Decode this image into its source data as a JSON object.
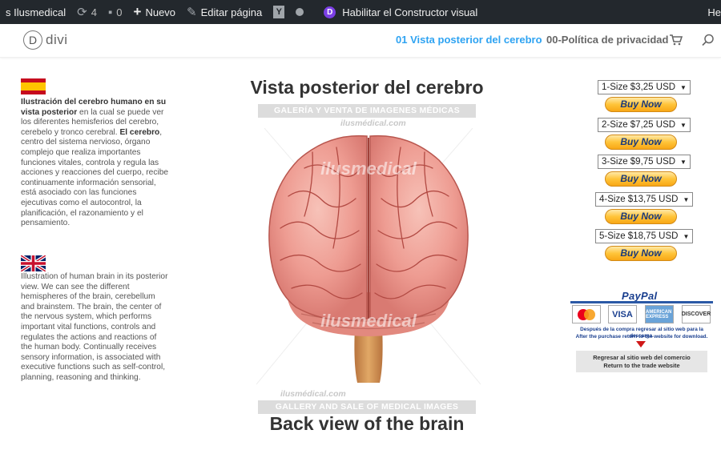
{
  "adminbar": {
    "site_name": "s Ilusmedical",
    "updates_count": "4",
    "comments_count": "0",
    "new_label": "Nuevo",
    "edit_label": "Editar página",
    "builder_label": "Habilitar el Constructor visual",
    "right_label": "He"
  },
  "header": {
    "logo_letter": "D",
    "logo_text": "divi",
    "nav_active": "01 Vista posterior del cerebro",
    "nav_item": "00-Política de privacidad"
  },
  "content": {
    "desc_es_bold1": "Ilustración del cerebro humano en su vista posterior",
    "desc_es_text1": " en la cual se puede ver los diferentes hemisferios del cerebro, cerebelo y tronco cerebral. ",
    "desc_es_bold2": "El cerebro",
    "desc_es_text2": ", centro del sistema nervioso, órgano complejo que realiza importantes funciones vitales, controla y regula las acciones y reacciones del cuerpo, recibe continuamente información sensorial, está asociado con las funciones ejecutivas como el autocontrol, la planificación, el razonamiento y el pensamiento.",
    "desc_en": "Illustration of human brain in its posterior view. We can see the different hemispheres of the brain, cerebellum and brainstem. The brain, the center of the nervous system, which performs important vital functions, controls and regulates the actions and reactions of the human body. Continually receives sensory information, is associated with executive functions such as self-control, planning, reasoning and thinking.",
    "title_es": "Vista posterior del cerebro",
    "title_en": "Back view of the brain",
    "banner_top": "GALERÍA Y VENTA DE IMAGENES MÉDICAS",
    "banner_bottom": "GALLERY AND SALE OF MEDICAL IMAGES",
    "site_mark_top": "ilusmédical.com",
    "site_mark_bottom": "ilusmédical.com",
    "watermark_1": "ilusmedical",
    "watermark_2": "ilusmedical"
  },
  "buy": {
    "button_label": "Buy Now",
    "sizes": [
      "1-Size $3,25 USD",
      "2-Size $7,25 USD",
      "3-Size $9,75 USD",
      "4-Size $13,75 USD",
      "5-Size $18,75 USD"
    ]
  },
  "paypal": {
    "logo": "PayPal",
    "card_visa": "VISA",
    "card_amex": "AMERICAN EXPRESS",
    "card_discover": "DISCOVER",
    "note_es": "Después de la compra regresar al sitio web para la descarga.",
    "note_en": "After the purchase return to the website for download.",
    "return_es": "Regresar al sitio web del comercio",
    "return_en": "Return to the trade website"
  },
  "colors": {
    "accent": "#2ea3f2",
    "adminbar_bg": "#23282d",
    "paypal_blue": "#1a3f8f",
    "button_gold": "#ffc439"
  },
  "icons": [
    "wordpress-updates-icon",
    "comment-icon",
    "plus-icon",
    "pencil-icon",
    "yoast-icon",
    "status-dot-icon",
    "divi-icon",
    "cart-icon",
    "search-icon",
    "spain-flag-icon",
    "uk-flag-icon"
  ]
}
